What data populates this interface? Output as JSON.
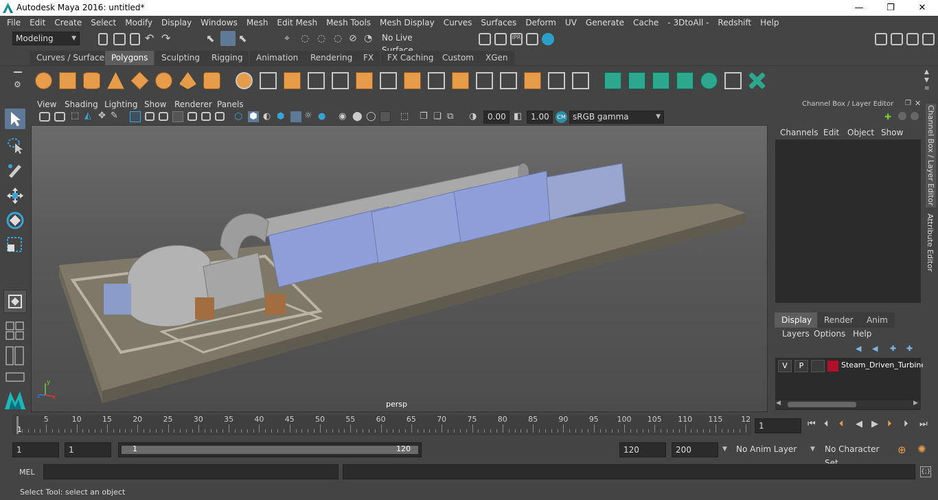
{
  "window": {
    "title": "Autodesk Maya 2016: untitled*",
    "minimize": "—",
    "maximize": "❐",
    "close": "✕"
  },
  "menu": [
    "File",
    "Edit",
    "Create",
    "Select",
    "Modify",
    "Display",
    "Windows",
    "Mesh",
    "Edit Mesh",
    "Mesh Tools",
    "Mesh Display",
    "Curves",
    "Surfaces",
    "Deform",
    "UV",
    "Generate",
    "Cache",
    "- 3DtoAll -",
    "Redshift",
    "Help"
  ],
  "status": {
    "mode": "Modeling",
    "live_surface": "No Live Surface"
  },
  "shelf_tabs": [
    "Curves / Surfaces",
    "Polygons",
    "Sculpting",
    "Rigging",
    "Animation",
    "Rendering",
    "FX",
    "FX Caching",
    "Custom",
    "XGen"
  ],
  "shelf_active": "Polygons",
  "panel_menu": [
    "View",
    "Shading",
    "Lighting",
    "Show",
    "Renderer",
    "Panels"
  ],
  "panel_tools": {
    "exposure": "0.00",
    "gamma": "1.00",
    "colorspace": "sRGB gamma"
  },
  "viewport": {
    "camera": "persp"
  },
  "channel_box": {
    "title": "Channel Box / Layer Editor",
    "menu": [
      "Channels",
      "Edit",
      "Object",
      "Show"
    ],
    "layer_tabs": [
      "Display",
      "Render",
      "Anim"
    ],
    "layer_menu": [
      "Layers",
      "Options",
      "Help"
    ],
    "layer": {
      "v": "V",
      "p": "P",
      "name": "Steam_Driven_Turbine",
      "color": "#b0102a"
    }
  },
  "side_tabs": [
    "Channel Box / Layer Editor",
    "Attribute Editor"
  ],
  "timeline": {
    "ticks": [
      "5",
      "10",
      "15",
      "20",
      "25",
      "30",
      "35",
      "40",
      "45",
      "50",
      "55",
      "60",
      "65",
      "70",
      "75",
      "80",
      "85",
      "90",
      "95",
      "100",
      "105",
      "110",
      "115",
      "12"
    ],
    "start_marker": "1",
    "current_frame": "1"
  },
  "range": {
    "start": "1",
    "playback_start": "1",
    "slider_start": "1",
    "slider_end": "120",
    "playback_end": "120",
    "end": "200",
    "anim_layer": "No Anim Layer",
    "char_set": "No Character Set"
  },
  "cmd": {
    "label": "MEL"
  },
  "help": "Select Tool: select an object",
  "colors": {
    "accent": "#5e7a96",
    "shelf_orange": "#e79c4a",
    "shelf_teal": "#2da88e",
    "machine_blue": "#8f9ed6",
    "layer_red": "#b0102a"
  }
}
